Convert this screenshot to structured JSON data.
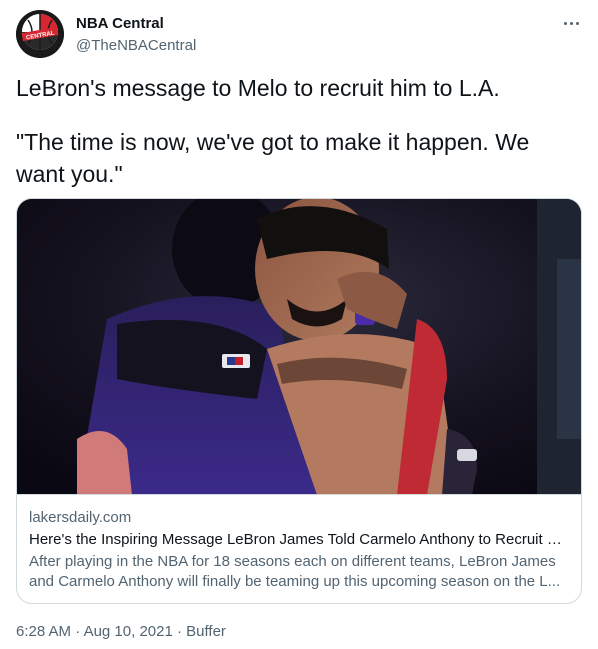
{
  "author": {
    "display_name": "NBA Central",
    "handle": "@TheNBACentral",
    "avatar_text": "CENTRAL",
    "avatar_icon": "basketball-logo-icon"
  },
  "more_icon": "ellipsis-icon",
  "tweet": {
    "line1": "LeBron's message to Melo to recruit him to L.A.",
    "line2": "\"The time is now, we've got to make it happen. We want you.\""
  },
  "card": {
    "image_icon": "photo-two-players-hugging",
    "domain": "lakersdaily.com",
    "title": "Here's the Inspiring Message LeBron James Told Carmelo Anthony to Recruit Hi...",
    "description": "After playing in the NBA for 18 seasons each on different teams, LeBron James and Carmelo Anthony will finally be teaming up this upcoming season on the L..."
  },
  "meta": {
    "time": "6:28 AM",
    "separator": "·",
    "date": "Aug 10, 2021",
    "source": "Buffer"
  },
  "colors": {
    "text": "#0f1419",
    "secondary": "#536471",
    "border": "#cfd9de",
    "logo_red": "#d62631"
  }
}
